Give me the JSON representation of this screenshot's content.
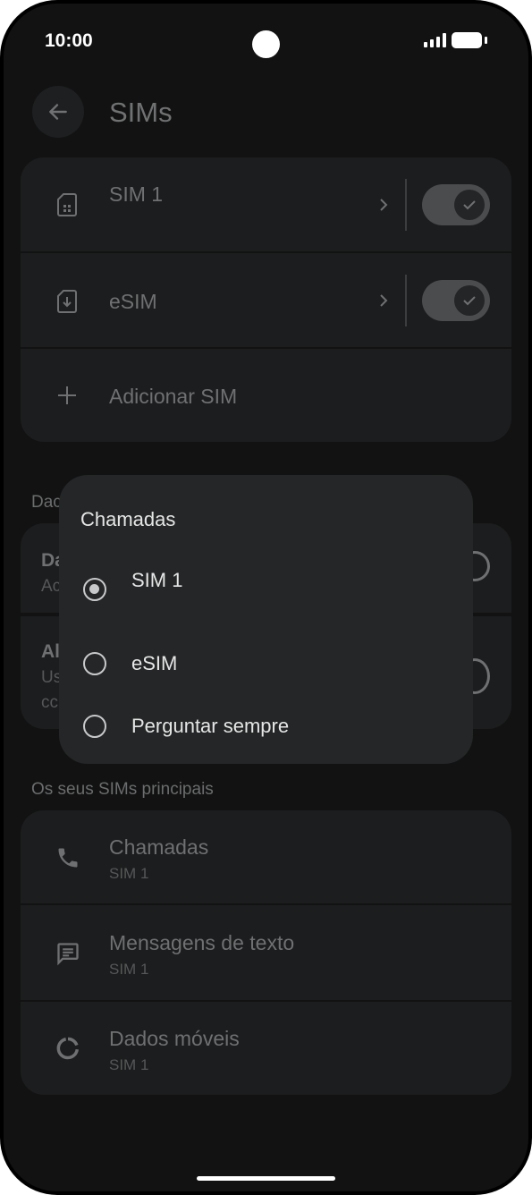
{
  "status": {
    "time": "10:00"
  },
  "header": {
    "title": "SIMs"
  },
  "sims": [
    {
      "label": "SIM 1",
      "enabled": true
    },
    {
      "label": "eSIM",
      "enabled": true
    }
  ],
  "add_sim": {
    "label": "Adicionar SIM"
  },
  "background_partial": {
    "section": "Dac",
    "row1_title": "Da",
    "row1_sub": "Ac",
    "row2_title": "Al",
    "row2_sub1": "Us",
    "row2_sub2": "cc"
  },
  "primary": {
    "section_title": "Os seus SIMs principais",
    "items": [
      {
        "label": "Chamadas",
        "value": "SIM 1",
        "icon": "phone-icon"
      },
      {
        "label": "Mensagens de texto",
        "value": "SIM 1",
        "icon": "message-icon"
      },
      {
        "label": "Dados móveis",
        "value": "SIM 1",
        "icon": "data-icon"
      }
    ]
  },
  "dialog": {
    "title": "Chamadas",
    "options": [
      {
        "label": "SIM 1",
        "selected": true
      },
      {
        "label": "eSIM",
        "selected": false
      },
      {
        "label": "Perguntar sempre",
        "selected": false
      }
    ]
  }
}
